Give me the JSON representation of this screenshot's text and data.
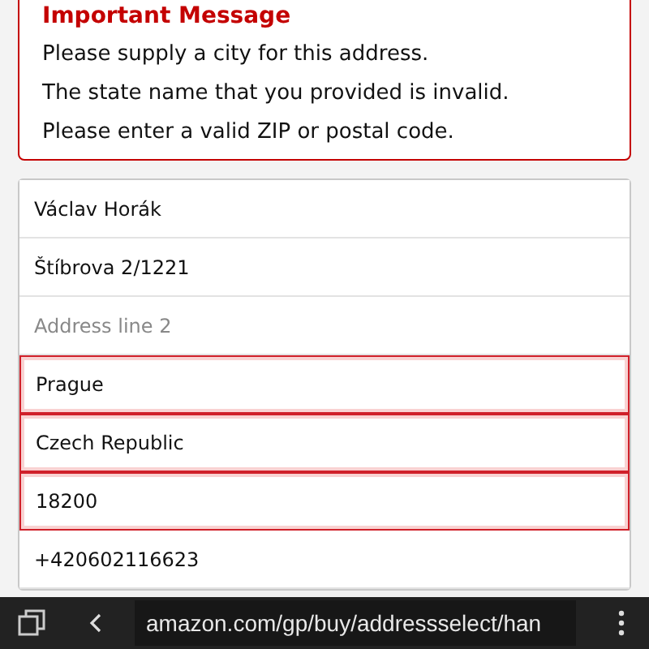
{
  "alert": {
    "title": "Important Message",
    "messages": [
      "Please supply a city for this address.",
      "The state name that you provided is invalid.",
      "Please enter a valid ZIP or postal code."
    ]
  },
  "address_form": {
    "fields": [
      {
        "value": "Václav Horák",
        "error": false
      },
      {
        "value": "Štíbrova 2/1221",
        "error": false
      },
      {
        "placeholder": "Address line 2",
        "error": false
      },
      {
        "value": "Prague",
        "error": true
      },
      {
        "value": "Czech Republic",
        "error": true
      },
      {
        "value": "18200",
        "error": true
      },
      {
        "value": "+420602116623",
        "error": false
      }
    ]
  },
  "browser_bar": {
    "url": "amazon.com/gp/buy/addressselect/han"
  }
}
